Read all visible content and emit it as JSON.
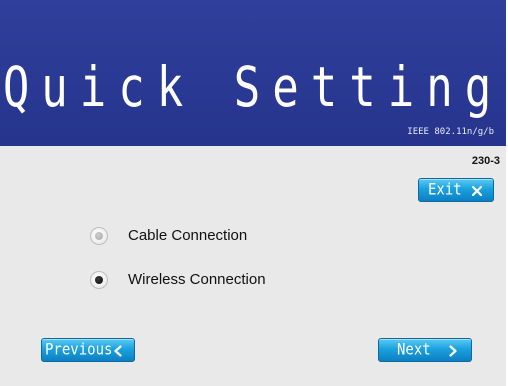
{
  "header": {
    "title": "Quick Setting",
    "standard": "IEEE 802.11n/g/b"
  },
  "page": {
    "code": "230-3"
  },
  "buttons": {
    "exit_label": "Exit",
    "previous_label": "Previous",
    "next_label": "Next"
  },
  "options": [
    {
      "label": "Cable Connection",
      "selected": false
    },
    {
      "label": "Wireless Connection",
      "selected": true
    }
  ],
  "icons": {
    "exit": "close-icon",
    "previous": "chevron-left-icon",
    "next": "chevron-right-icon"
  },
  "colors": {
    "header_bg": "#2c3b96",
    "content_bg": "#e9e9e9",
    "button_bg": "#1ba1df",
    "text": "#111111",
    "white": "#ffffff"
  }
}
